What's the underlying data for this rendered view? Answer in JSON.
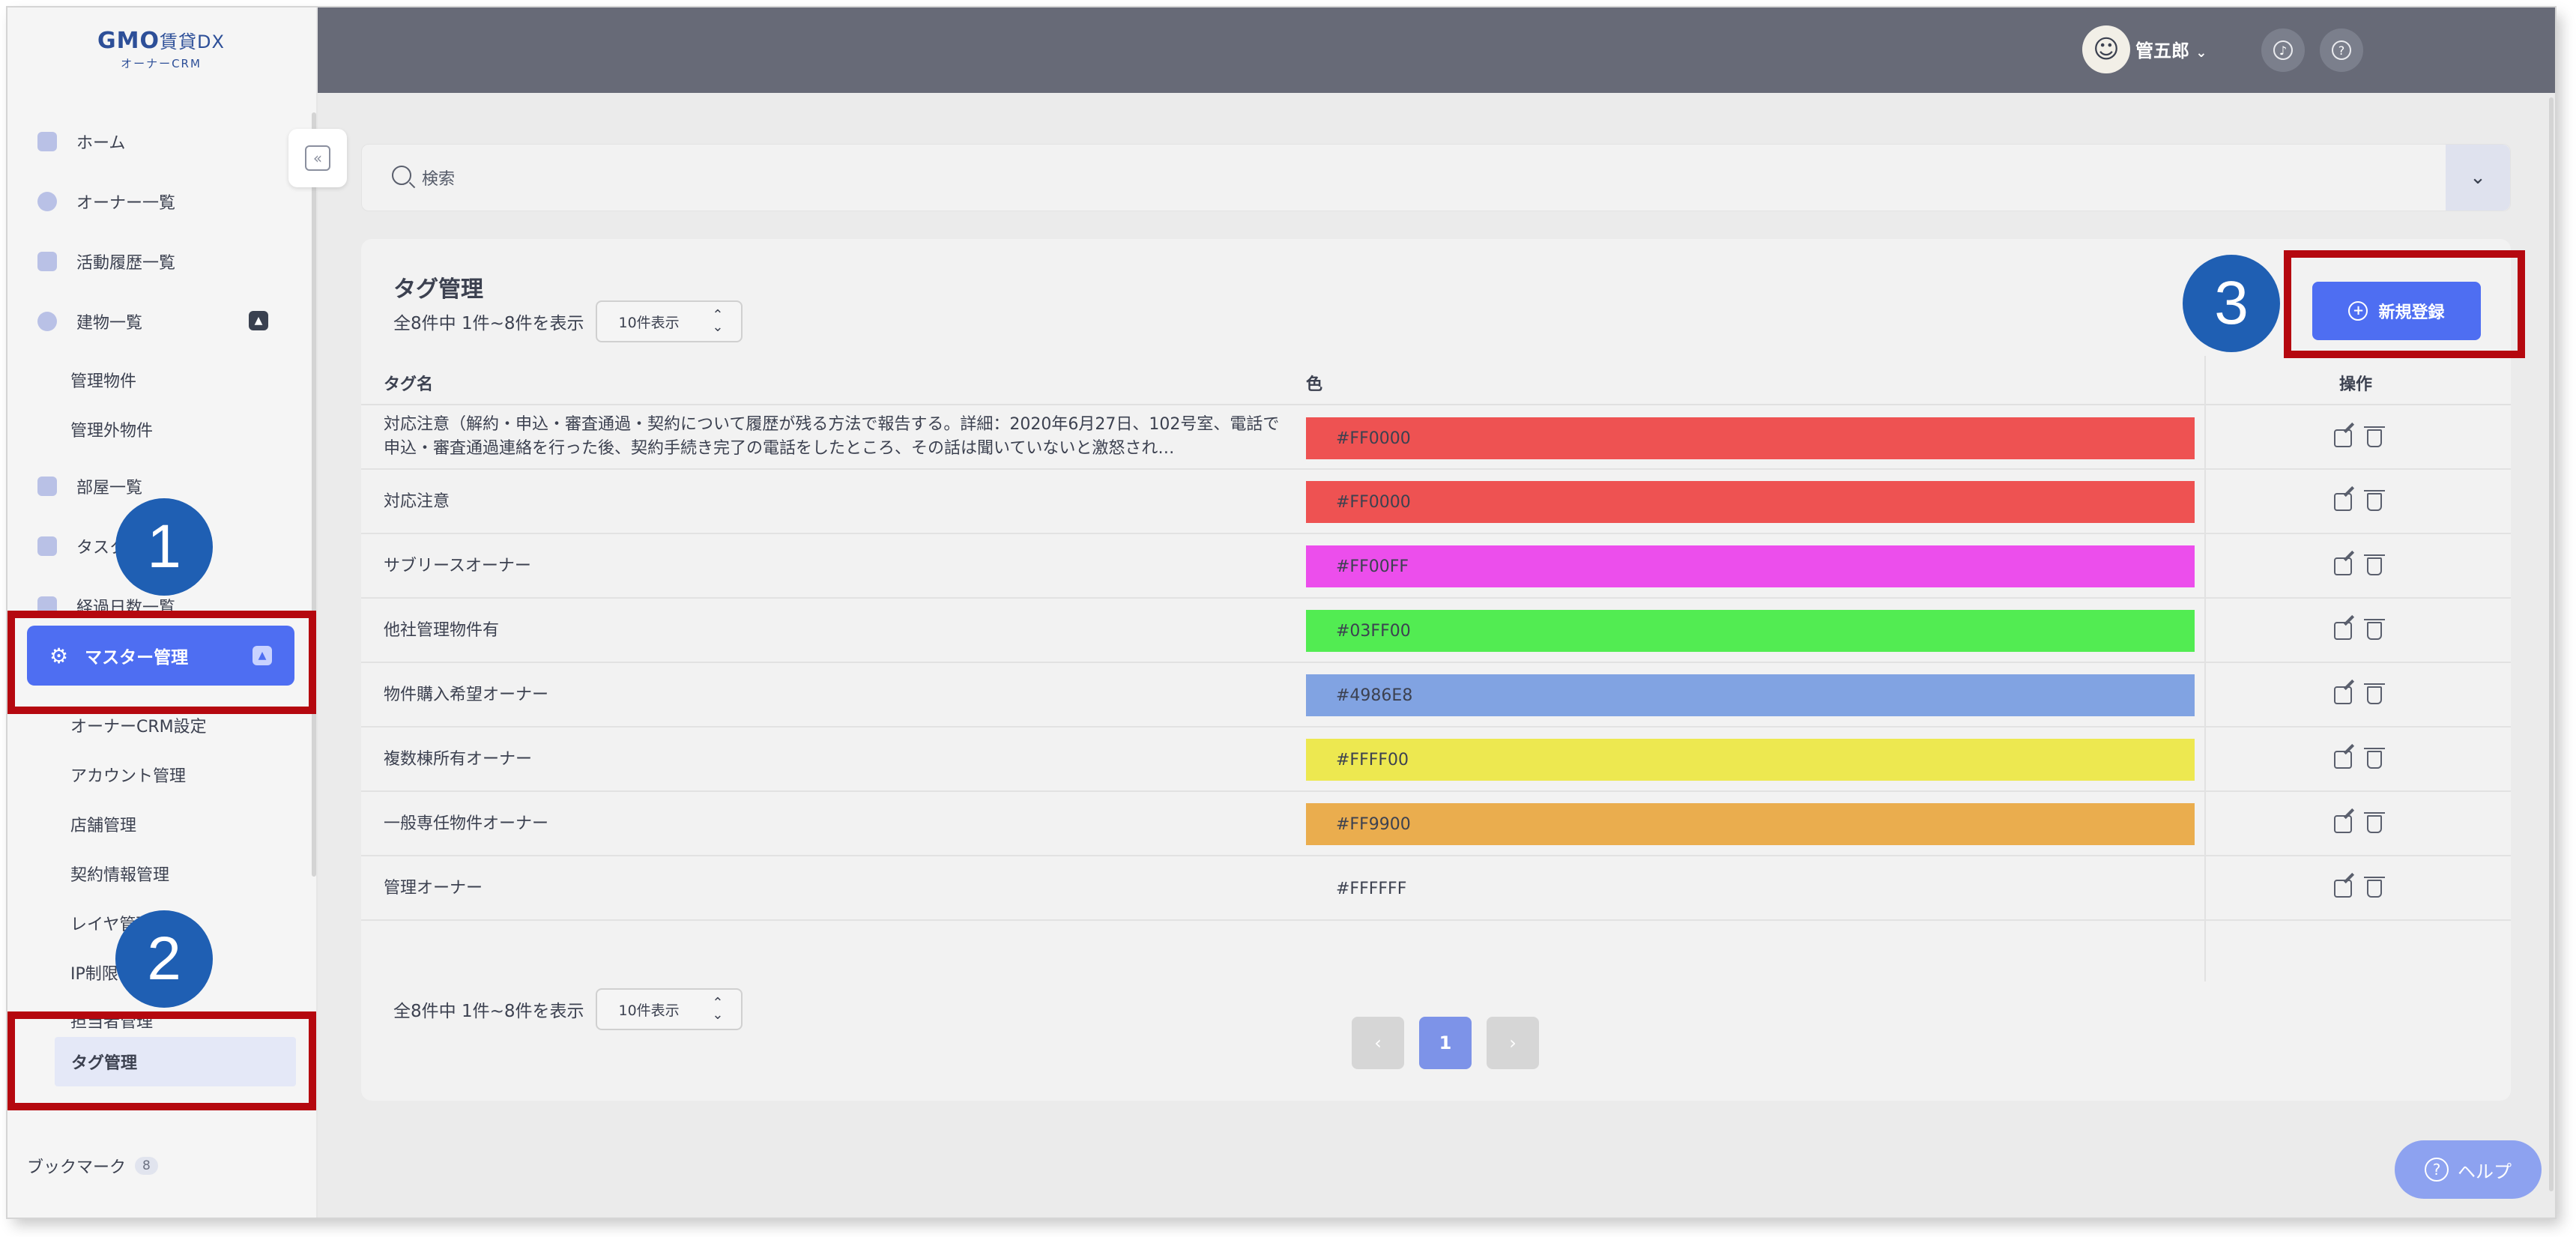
{
  "logo": {
    "main": "GMO",
    "suffix": "賃貸DX",
    "sub": "オーナーCRM"
  },
  "sidebar": {
    "home": "ホーム",
    "owners": "オーナー一覧",
    "activity": "活動履歴一覧",
    "buildings": "建物一覧",
    "buildings_sub": [
      "管理物件",
      "管理外物件"
    ],
    "rooms": "部屋一覧",
    "tasks": "タスク",
    "elapsed": "経過日数一覧",
    "master": "マスター管理",
    "master_sub": [
      "オーナーCRM設定",
      "アカウント管理",
      "店舗管理",
      "契約情報管理",
      "レイヤ管理",
      "IP制限",
      "担当者管理"
    ],
    "tag": "タグ管理",
    "bookmark": "ブックマーク",
    "bookmark_count": "8"
  },
  "topbar": {
    "username": "管五郎"
  },
  "search": {
    "placeholder": "検索"
  },
  "card": {
    "title": "タグ管理",
    "count_text": "全8件中 1件~8件を表示",
    "per_page": "10件表示",
    "new_button": "新規登録"
  },
  "table": {
    "headers": [
      "タグ名",
      "色",
      "操作"
    ],
    "rows": [
      {
        "name": "対応注意（解約・申込・審査通過・契約について履歴が残る方法で報告する。詳細：2020年6月27日、102号室、電話で申込・審査通過連絡を行った後、契約手続き完了の電話をしたところ、その話は聞いていないと激怒され…",
        "color": "#FF0000",
        "swatch": "#ee5252"
      },
      {
        "name": "対応注意",
        "color": "#FF0000",
        "swatch": "#ee5252"
      },
      {
        "name": "サブリースオーナー",
        "color": "#FF00FF",
        "swatch": "#ec4eec"
      },
      {
        "name": "他社管理物件有",
        "color": "#03FF00",
        "swatch": "#52ec52"
      },
      {
        "name": "物件購入希望オーナー",
        "color": "#4986E8",
        "swatch": "#81a3e2"
      },
      {
        "name": "複数棟所有オーナー",
        "color": "#FFFF00",
        "swatch": "#ede850"
      },
      {
        "name": "一般専任物件オーナー",
        "color": "#FF9900",
        "swatch": "#eaad4e"
      },
      {
        "name": "管理オーナー",
        "color": "#FFFFFF",
        "swatch": "transparent"
      }
    ]
  },
  "pagination": {
    "prev": "‹",
    "current": "1",
    "next": "›"
  },
  "help": {
    "label": "ヘルプ"
  },
  "markers": [
    "1",
    "2",
    "3"
  ]
}
